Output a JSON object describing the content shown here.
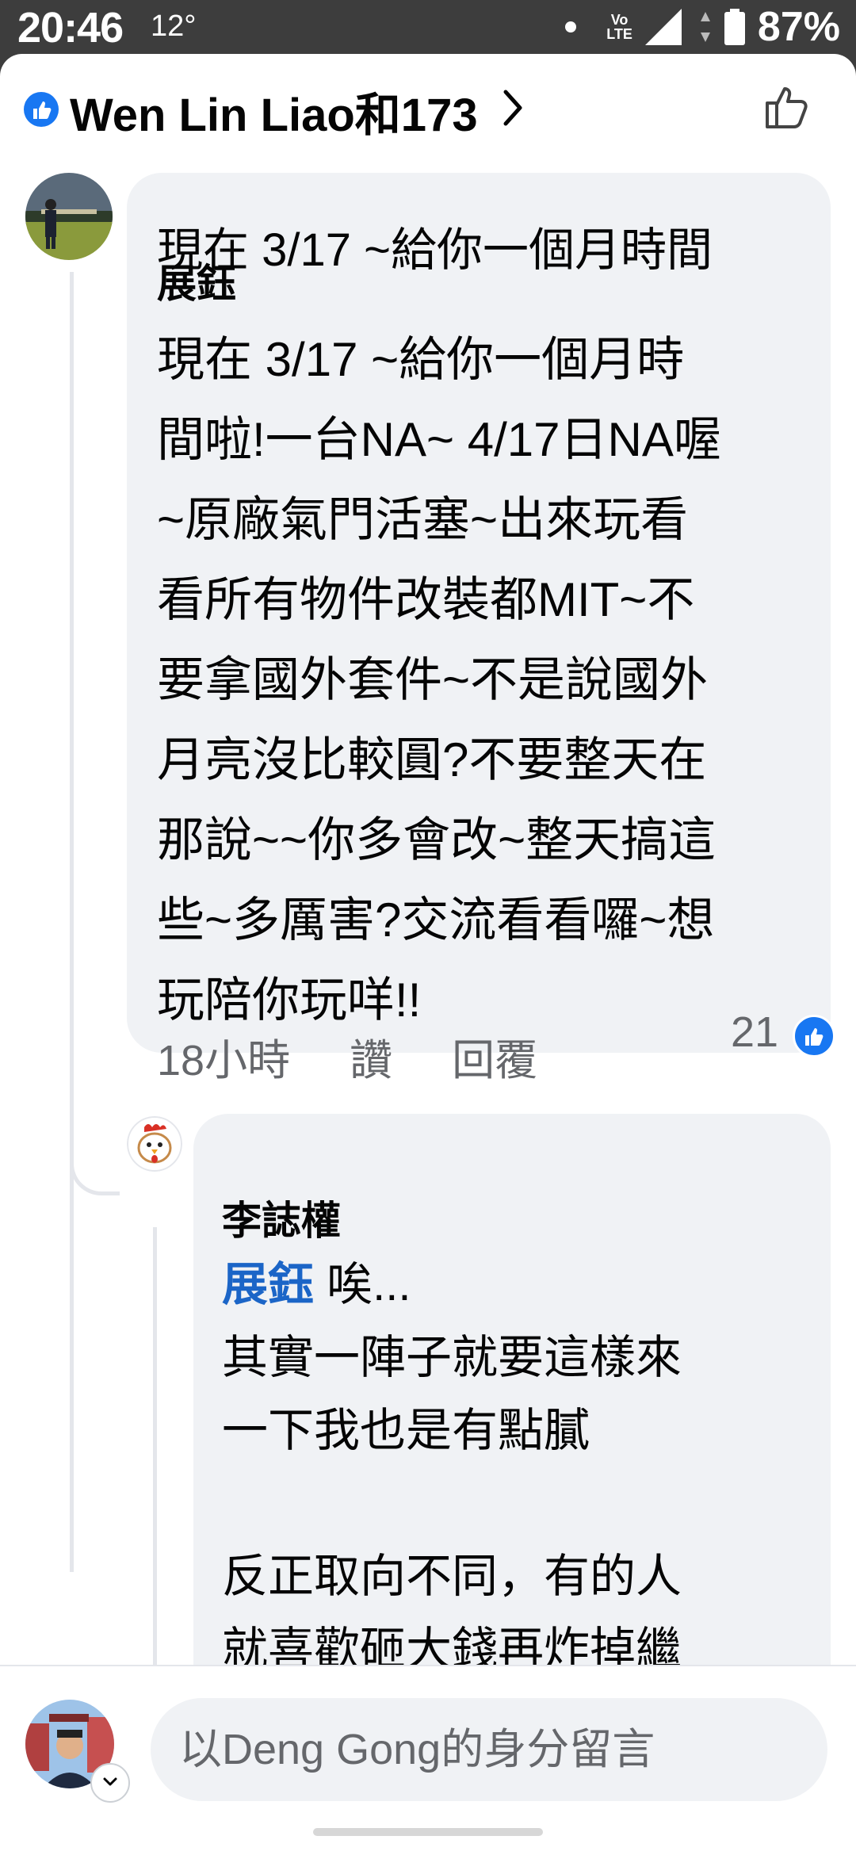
{
  "status_bar": {
    "time": "20:46",
    "temperature": "12°",
    "network": "VoLTE",
    "battery": "87%"
  },
  "header": {
    "title": "Wen Lin Liao和173",
    "icons": [
      "like-badge-icon",
      "chevron-right-icon",
      "thumbs-up-outline-icon"
    ]
  },
  "comment": {
    "author": "展鈺",
    "text": "現在 3/17 ~給你一個月時\n間啦!一台NA~ 4/17日NA喔\n~原廠氣門活塞~出來玩看\n看所有物件改裝都MIT~不\n要拿國外套件~不是說國外\n月亮沒比較圓?不要整天在\n那說~~你多會改~整天搞這\n些~多厲害?交流看看囉~想\n玩陪你玩咩!!",
    "time": "18小時",
    "like_label": "讚",
    "reply_label": "回覆",
    "reaction_count": "21"
  },
  "reply": {
    "author": "李誌權",
    "mention": "展鈺",
    "text_first": "唉...",
    "text_rest": "其實一陣子就要這樣來\n一下我也是有點膩\n\n反正取向不同，有的人\n就喜歡砸大錢再炸掉繼"
  },
  "composer": {
    "placeholder": "以Deng Gong的身分留言",
    "peek_text": "現在 3/17 ~給你一個月時間"
  },
  "colors": {
    "accent": "#1877f2",
    "mention": "#1b65c7",
    "bubble": "#f0f2f5",
    "secondary_text": "#65676b"
  }
}
